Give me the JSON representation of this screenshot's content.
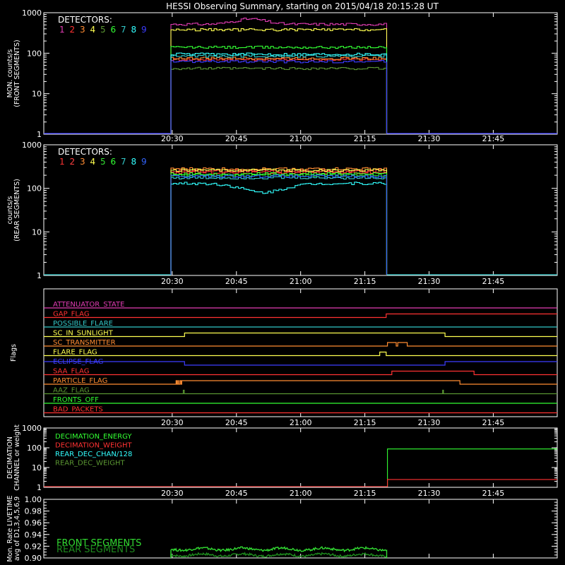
{
  "title": "HESSI Observing Summary, starting on 2015/04/18 20:15:28 UT",
  "colors": {
    "det": [
      "#ff3232",
      "#ff4040",
      "#ff8c32",
      "#ffff50",
      "#32dc32",
      "#32ff32",
      "#32c8c8",
      "#32ffff",
      "#3264ff"
    ],
    "front_det": [
      "#e23cb4",
      "#ff3232",
      "#ff8c32",
      "#ffff50",
      "#5a9632",
      "#32ff32",
      "#32c8c8",
      "#32ffff",
      "#3c3cff"
    ]
  },
  "chart_data": [
    {
      "type": "line",
      "name": "front",
      "ylabel": [
        "MON. counts/s",
        "(FRONT SEGMENTS)"
      ],
      "yscale": "log",
      "ylim": [
        1,
        1000
      ],
      "ytick_labels": [
        "1",
        "10",
        "100",
        "1000"
      ],
      "xtick_labels": [
        "20:30",
        "20:45",
        "21:00",
        "21:15",
        "21:30",
        "21:45"
      ],
      "legend_title": "DETECTORS:",
      "legend": [
        "1",
        "2",
        "3",
        "4",
        "5",
        "6",
        "7",
        "8",
        "9"
      ],
      "series": [
        {
          "name": "1",
          "level": 520,
          "bump": [
            20.8,
            0.35
          ]
        },
        {
          "name": "2",
          "level": 70
        },
        {
          "name": "3",
          "level": 75
        },
        {
          "name": "4",
          "level": 380
        },
        {
          "name": "5",
          "level": 42
        },
        {
          "name": "6",
          "level": 140
        },
        {
          "name": "7",
          "level": 85
        },
        {
          "name": "8",
          "level": 95
        },
        {
          "name": "9",
          "level": 62
        }
      ]
    },
    {
      "type": "line",
      "name": "rear",
      "ylabel": [
        "counts/s",
        "(REAR SEGMENTS)"
      ],
      "yscale": "log",
      "ylim": [
        1,
        1000
      ],
      "ytick_labels": [
        "1",
        "10",
        "100",
        "1000"
      ],
      "xtick_labels": [
        "20:30",
        "20:45",
        "21:00",
        "21:15",
        "21:30",
        "21:45"
      ],
      "legend_title": "DETECTORS:",
      "legend": [
        "1",
        "2",
        "3",
        "4",
        "5",
        "6",
        "7",
        "8",
        "9"
      ],
      "series": [
        {
          "name": "1",
          "level": 230
        },
        {
          "name": "2",
          "level": 250
        },
        {
          "name": "3",
          "level": 280
        },
        {
          "name": "4",
          "level": 260
        },
        {
          "name": "5",
          "level": 200
        },
        {
          "name": "6",
          "level": 215
        },
        {
          "name": "7",
          "level": 175
        },
        {
          "name": "8",
          "level": 130,
          "dip": true
        },
        {
          "name": "9",
          "level": 190
        }
      ]
    },
    {
      "type": "flags",
      "name": "flags",
      "ylabel": [
        "Flags"
      ],
      "xtick_labels": [
        "20:30",
        "20:45",
        "21:00",
        "21:15",
        "21:30",
        "21:45"
      ],
      "flags": [
        {
          "label": "ATTENUATOR_STATE",
          "color": "#e23cb4",
          "on": []
        },
        {
          "label": "GAP_FLAG",
          "color": "#ff3232",
          "on": [
            [
              21.333,
              21.999
            ]
          ]
        },
        {
          "label": "POSSIBLE_FLARE",
          "color": "#32c8c8",
          "on": []
        },
        {
          "label": "SC_IN_SUNLIGHT",
          "color": "#ffff50",
          "on": [
            [
              20.548,
              21.562
            ]
          ]
        },
        {
          "label": "SC_TRANSMITTER",
          "color": "#ff8c32",
          "on": [
            [
              21.338,
              21.372
            ],
            [
              21.378,
              21.415
            ]
          ]
        },
        {
          "label": "FLARE_FLAG",
          "color": "#ffff50",
          "on": [
            [
              21.308,
              21.333
            ]
          ]
        },
        {
          "label": "ECLIPSE_FLAG",
          "color": "#3c3cff",
          "on": [
            [
              20.0,
              20.548
            ],
            [
              21.562,
              21.999
            ]
          ]
        },
        {
          "label": "SAA_FLAG",
          "color": "#ff3232",
          "on": [
            [
              21.355,
              21.675
            ]
          ]
        },
        {
          "label": "PARTICLE_FLAG",
          "color": "#ff8c32",
          "on": [
            [
              20.515,
              20.518
            ],
            [
              20.522,
              20.525
            ],
            [
              20.53,
              20.534
            ],
            [
              20.537,
              21.62
            ]
          ]
        },
        {
          "label": "AAZ_FLAG",
          "color": "#5a9632",
          "on": [
            [
              20.543,
              20.547
            ],
            [
              21.553,
              21.556
            ]
          ]
        },
        {
          "label": "FRONTS_OFF",
          "color": "#32ff32",
          "on": []
        },
        {
          "label": "BAD_PACKETS",
          "color": "#ff3232",
          "on": []
        }
      ]
    },
    {
      "type": "line",
      "name": "decimation",
      "ylabel": [
        "DECIMATION",
        "CHANNEL or weight"
      ],
      "yscale": "log",
      "ylim": [
        1,
        1000
      ],
      "ytick_labels": [
        "1",
        "10",
        "100",
        "1000"
      ],
      "xtick_labels": [
        "20:30",
        "20:45",
        "21:00",
        "21:15",
        "21:30",
        "21:45"
      ],
      "legend": [
        {
          "label": "DECIMATION_ENERGY",
          "color": "#32ff32"
        },
        {
          "label": "DECIMATION_WEIGHT",
          "color": "#ff3232"
        },
        {
          "label": "REAR_DEC_CHAN/128",
          "color": "#32ffff"
        },
        {
          "label": "REAR_DEC_WEIGHT",
          "color": "#5a9632"
        }
      ],
      "series": [
        {
          "name": "DECIMATION_ENERGY",
          "color": "#32ff32",
          "steps": [
            [
              20.0,
              1
            ],
            [
              21.338,
              1
            ],
            [
              21.338,
              80
            ],
            [
              21.999,
              80
            ]
          ]
        },
        {
          "name": "DECIMATION_WEIGHT",
          "color": "#ff3232",
          "steps": [
            [
              20.0,
              1
            ],
            [
              21.338,
              1
            ],
            [
              21.338,
              2.3
            ],
            [
              21.999,
              2.3
            ]
          ]
        }
      ]
    },
    {
      "type": "line",
      "name": "livetime",
      "ylabel": [
        "Mon. Rate LIVETIME",
        "avg of D1,3,4,5,6,9"
      ],
      "ylim": [
        0.9,
        1.0
      ],
      "ytick_labels": [
        "0.90",
        "0.92",
        "0.94",
        "0.96",
        "0.98",
        "1.00"
      ],
      "legend": [
        {
          "label": "FRONT SEGMENTS",
          "color": "#32dc32"
        },
        {
          "label": "REAR SEGMENTS",
          "color": "#1e8c1e"
        }
      ],
      "series": [
        {
          "name": "FRONT SEGMENTS",
          "color": "#32dc32",
          "level": 0.915
        },
        {
          "name": "REAR SEGMENTS",
          "color": "#1e8c1e",
          "level": 0.905
        }
      ]
    }
  ]
}
